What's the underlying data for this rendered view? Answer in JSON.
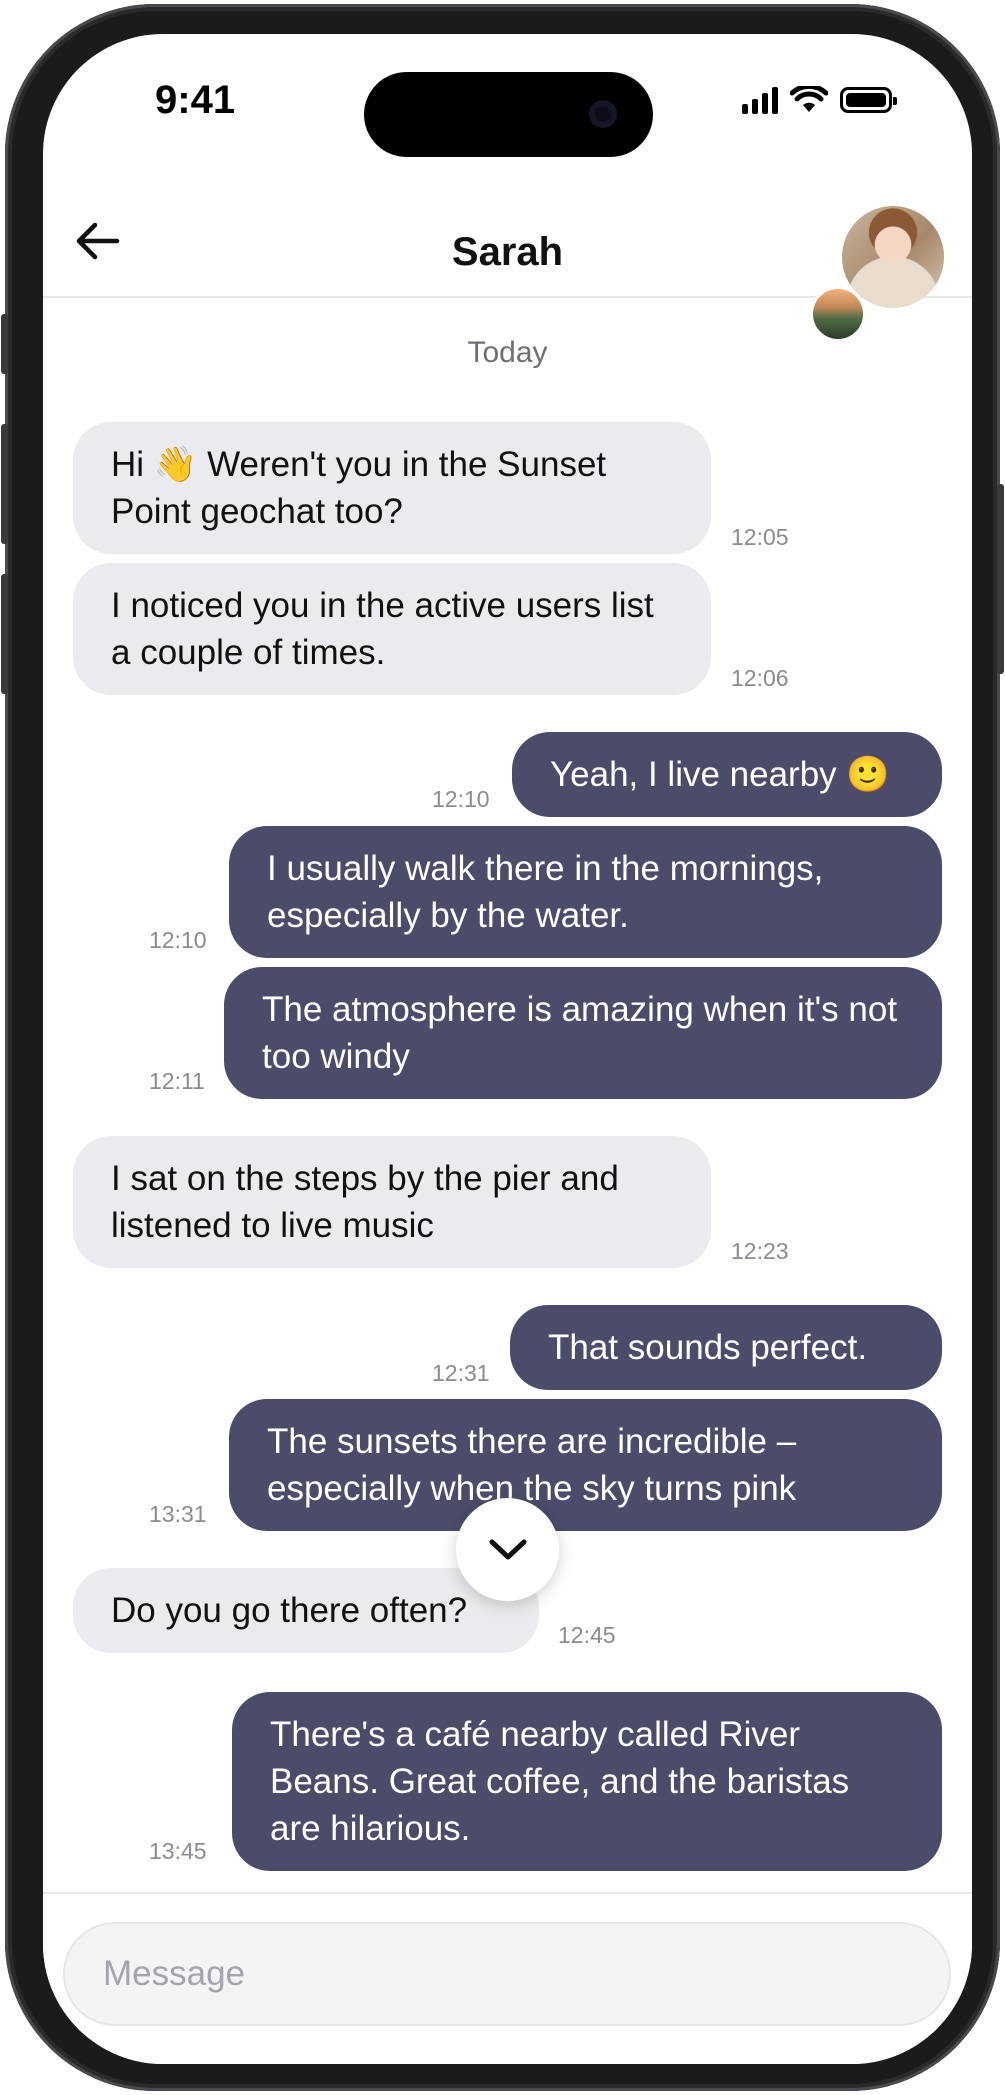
{
  "status_bar": {
    "time": "9:41"
  },
  "header": {
    "contact_name": "Sarah",
    "back_icon": "arrow-left-icon"
  },
  "chat": {
    "day_label": "Today",
    "messages": [
      {
        "side": "in",
        "text": "Hi 👋 Weren't you in the Sunset Point geochat too?",
        "time": "12:05"
      },
      {
        "side": "in",
        "text": "I noticed you in the active users list a couple of times.",
        "time": "12:06"
      },
      {
        "side": "out",
        "text": "Yeah, I live nearby 🙂",
        "time": "12:10"
      },
      {
        "side": "out",
        "text": "I usually walk there in the mornings, especially by the water.",
        "time": "12:10"
      },
      {
        "side": "out",
        "text": "The atmosphere is amazing when it's not too windy",
        "time": "12:11"
      },
      {
        "side": "in",
        "text": "I sat on the steps by the pier and listened to live music",
        "time": "12:23"
      },
      {
        "side": "out",
        "text": "That sounds perfect.",
        "time": "12:31"
      },
      {
        "side": "out",
        "text": "The sunsets there are incredible – especially when the sky turns pink",
        "time": "13:31"
      },
      {
        "side": "in",
        "text": "Do you go there often?",
        "time": "12:45"
      },
      {
        "side": "out",
        "text": "There's a café nearby called River Beans. Great coffee, and the baristas are hilarious.",
        "time": "13:45"
      }
    ]
  },
  "composer": {
    "placeholder": "Message",
    "value": ""
  },
  "colors": {
    "incoming_bubble": "#ebebef",
    "outgoing_bubble": "#4b4c6a",
    "timestamp": "#8a8a92"
  }
}
